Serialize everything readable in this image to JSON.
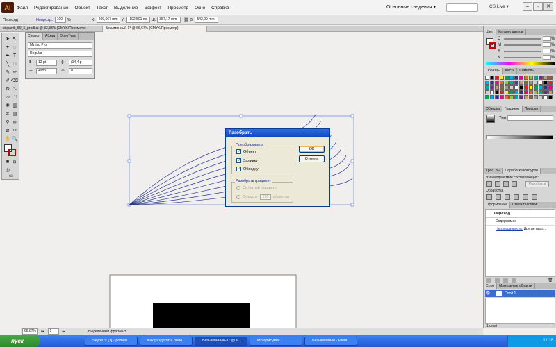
{
  "app": {
    "logo": "Ai",
    "workspace": "Основные сведения ▾",
    "cslive": "CS Live ▾"
  },
  "menu": [
    "Файл",
    "Редактирование",
    "Объект",
    "Текст",
    "Выделение",
    "Эффект",
    "Просмотр",
    "Окно",
    "Справка"
  ],
  "control_bar": {
    "label": "Переход",
    "opacity_label": "Непрозр.:",
    "opacity": "100",
    "pct": "%",
    "x_label": "X:",
    "x": "209,667 mm",
    "y_label": "Y:",
    "y": "-192,501 mr",
    "w_label": "Ш:",
    "w": "357,17 mm",
    "h_label": "В:",
    "h": "542,29 mm"
  },
  "doc_tabs": [
    "stvpanik_59_5_prodl.ai @ 33,33% (CMYK/Просмотр)",
    "Безымянный-1* @ 66,67% (CMYK/Просмотр)"
  ],
  "char_panel": {
    "tabs": [
      "Символ",
      "Абзац",
      "ОрепType"
    ],
    "font": "Myriad Pro",
    "style": "Regular",
    "size": "12 pt",
    "leading": "(14,4 p",
    "tracking": "Авто",
    "kerning": "0"
  },
  "dialog": {
    "title": "Разобрать",
    "group1_label": "Преобразовать",
    "object": "Объект",
    "fill": "Заливку",
    "stroke": "Обводку",
    "group2_label": "Разобрать градиент",
    "gradient_mesh": "Сетчатый градиент",
    "create": "Создать:",
    "objects_count": "255",
    "objects": "объектов",
    "ok": "ОК",
    "cancel": "Отмена"
  },
  "right_panels": {
    "color_tabs": [
      "Цвет",
      "Каталог цветов"
    ],
    "channels": [
      "C",
      "M",
      "Y",
      "K"
    ],
    "pct": "%",
    "swatch_tabs": [
      "Образцы",
      "Кисти",
      "Символы"
    ],
    "gradient_tabs": [
      "Обводка",
      "Градиент",
      "Прозрач"
    ],
    "gradient_type_label": "Тип:",
    "pathfinder_tabs": [
      "Трас. Вы",
      "Обработка контуров"
    ],
    "shape_modes": "Взаимодействие составляющих:",
    "expand": "Разобрать",
    "pathfinder": "Обработка",
    "appearance_tabs": [
      "Оформление",
      "Стили графики"
    ],
    "appearance_title": "Переход",
    "content": "Содержимое",
    "opacity_link": "Непрозрачность:",
    "opacity_val": "Другие пара...",
    "layers_tabs": [
      "Слои",
      "Монтажные области"
    ],
    "layer1": "Слой 1",
    "layers_count": "1 слой"
  },
  "status": {
    "zoom": "66,67%",
    "page": "1",
    "tool": "Выделенный фрагмент"
  },
  "taskbar": {
    "start": "пуск",
    "items": [
      "Skype™ [1] - pomeh...",
      "Как разделить поло...",
      "Безымянный-1* @ 6...",
      "Мои рисунки",
      "Безымянный - Paint"
    ],
    "clock": "11:18"
  },
  "colors": {
    "accent": "#2d6be0",
    "path": "#2a3a8e",
    "selection": "#5570d8"
  }
}
